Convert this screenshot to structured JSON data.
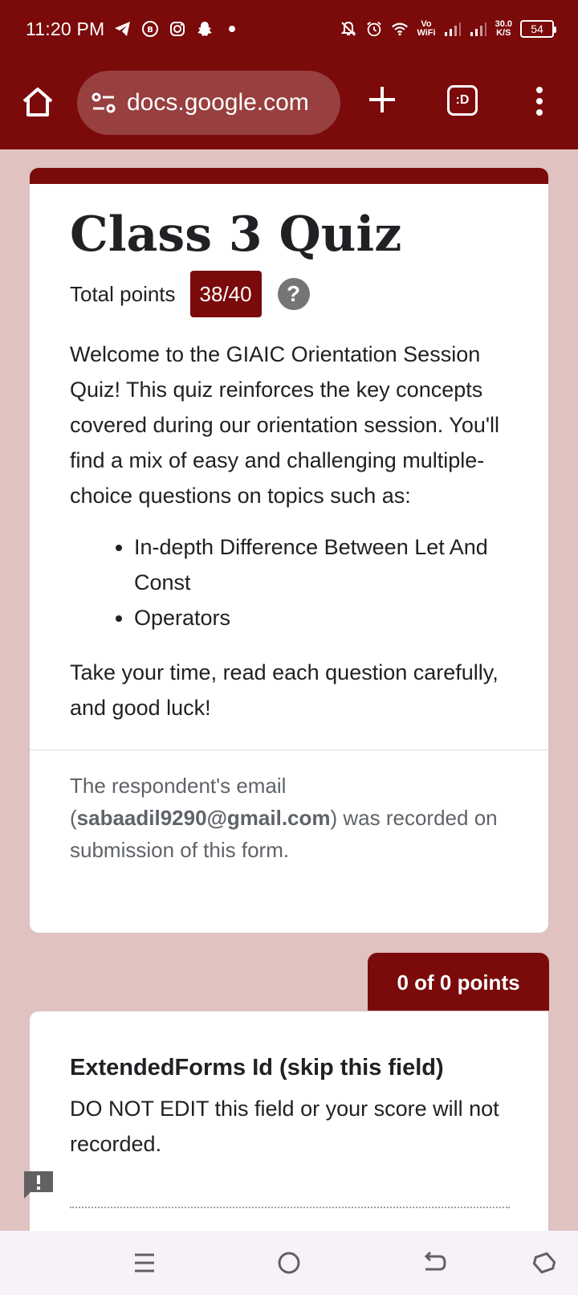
{
  "status_bar": {
    "time": "11:20 PM",
    "speed_value": "30.0",
    "speed_unit": "K/S",
    "battery": "54",
    "wifi_label_top": "Vo",
    "wifi_label_bottom": "WiFi",
    "icons": [
      "telegram-icon",
      "bip-icon",
      "instagram-icon",
      "snapchat-icon",
      "dot-icon",
      "bell-off-icon",
      "alarm-icon",
      "wifi-icon",
      "signal-icon"
    ]
  },
  "browser": {
    "url": "docs.google.com",
    "tabs_label": ":D"
  },
  "form": {
    "title": "Class 3 Quiz",
    "total_points_label": "Total points",
    "total_points_value": "38/40",
    "help_symbol": "?",
    "description": "Welcome to the GIAIC Orientation Session Quiz! This quiz reinforces the key concepts covered during our orientation session. You'll find a mix of easy and challenging multiple-choice questions on topics such as:",
    "topics": [
      "In-depth Difference Between Let And Const",
      "Operators"
    ],
    "closing": "Take your time, read each question carefully, and good luck!",
    "email_prefix": "The respondent's email (",
    "email": "sabaadil9290@gmail.com",
    "email_suffix": ") was recorded on submission of this form."
  },
  "question": {
    "points": "0 of 0 points",
    "title": "ExtendedForms Id (skip this field)",
    "description": "DO NOT EDIT this field or your score will not recorded."
  },
  "colors": {
    "brand": "#7b0a0b",
    "page_bg": "#e0c2c1"
  }
}
